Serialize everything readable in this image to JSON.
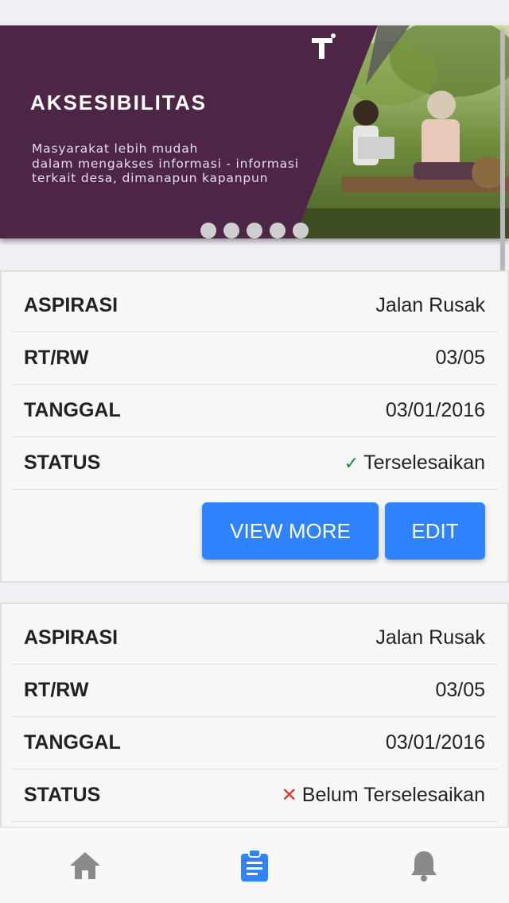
{
  "banner": {
    "title": "AKSESIBILITAS",
    "description_line1": "Masyarakat lebih mudah",
    "description_line2": "dalam mengakses informasi - informasi",
    "description_line3": "terkait desa, dimanapun kapanpun",
    "dot_count": 5,
    "background_color": "#4d2547"
  },
  "cards": [
    {
      "aspirasi_label": "ASPIRASI",
      "aspirasi_value": "Jalan Rusak",
      "rtrw_label": "RT/RW",
      "rtrw_value": "03/05",
      "tanggal_label": "TANGGAL",
      "tanggal_value": "03/01/2016",
      "status_label": "STATUS",
      "status_value": "Terselesaikan",
      "status_icon": "check-icon",
      "view_more_label": "VIEW MORE",
      "edit_label": "EDIT"
    },
    {
      "aspirasi_label": "ASPIRASI",
      "aspirasi_value": "Jalan Rusak",
      "rtrw_label": "RT/RW",
      "rtrw_value": "03/05",
      "tanggal_label": "TANGGAL",
      "tanggal_value": "03/01/2016",
      "status_label": "STATUS",
      "status_value": "Belum Terselesaikan",
      "status_icon": "cross-icon"
    }
  ],
  "nav": {
    "items": [
      "home-icon",
      "clipboard-icon",
      "bell-icon"
    ],
    "active": "clipboard-icon",
    "active_color": "#2f83ff",
    "inactive_color": "#8a8a8a"
  }
}
